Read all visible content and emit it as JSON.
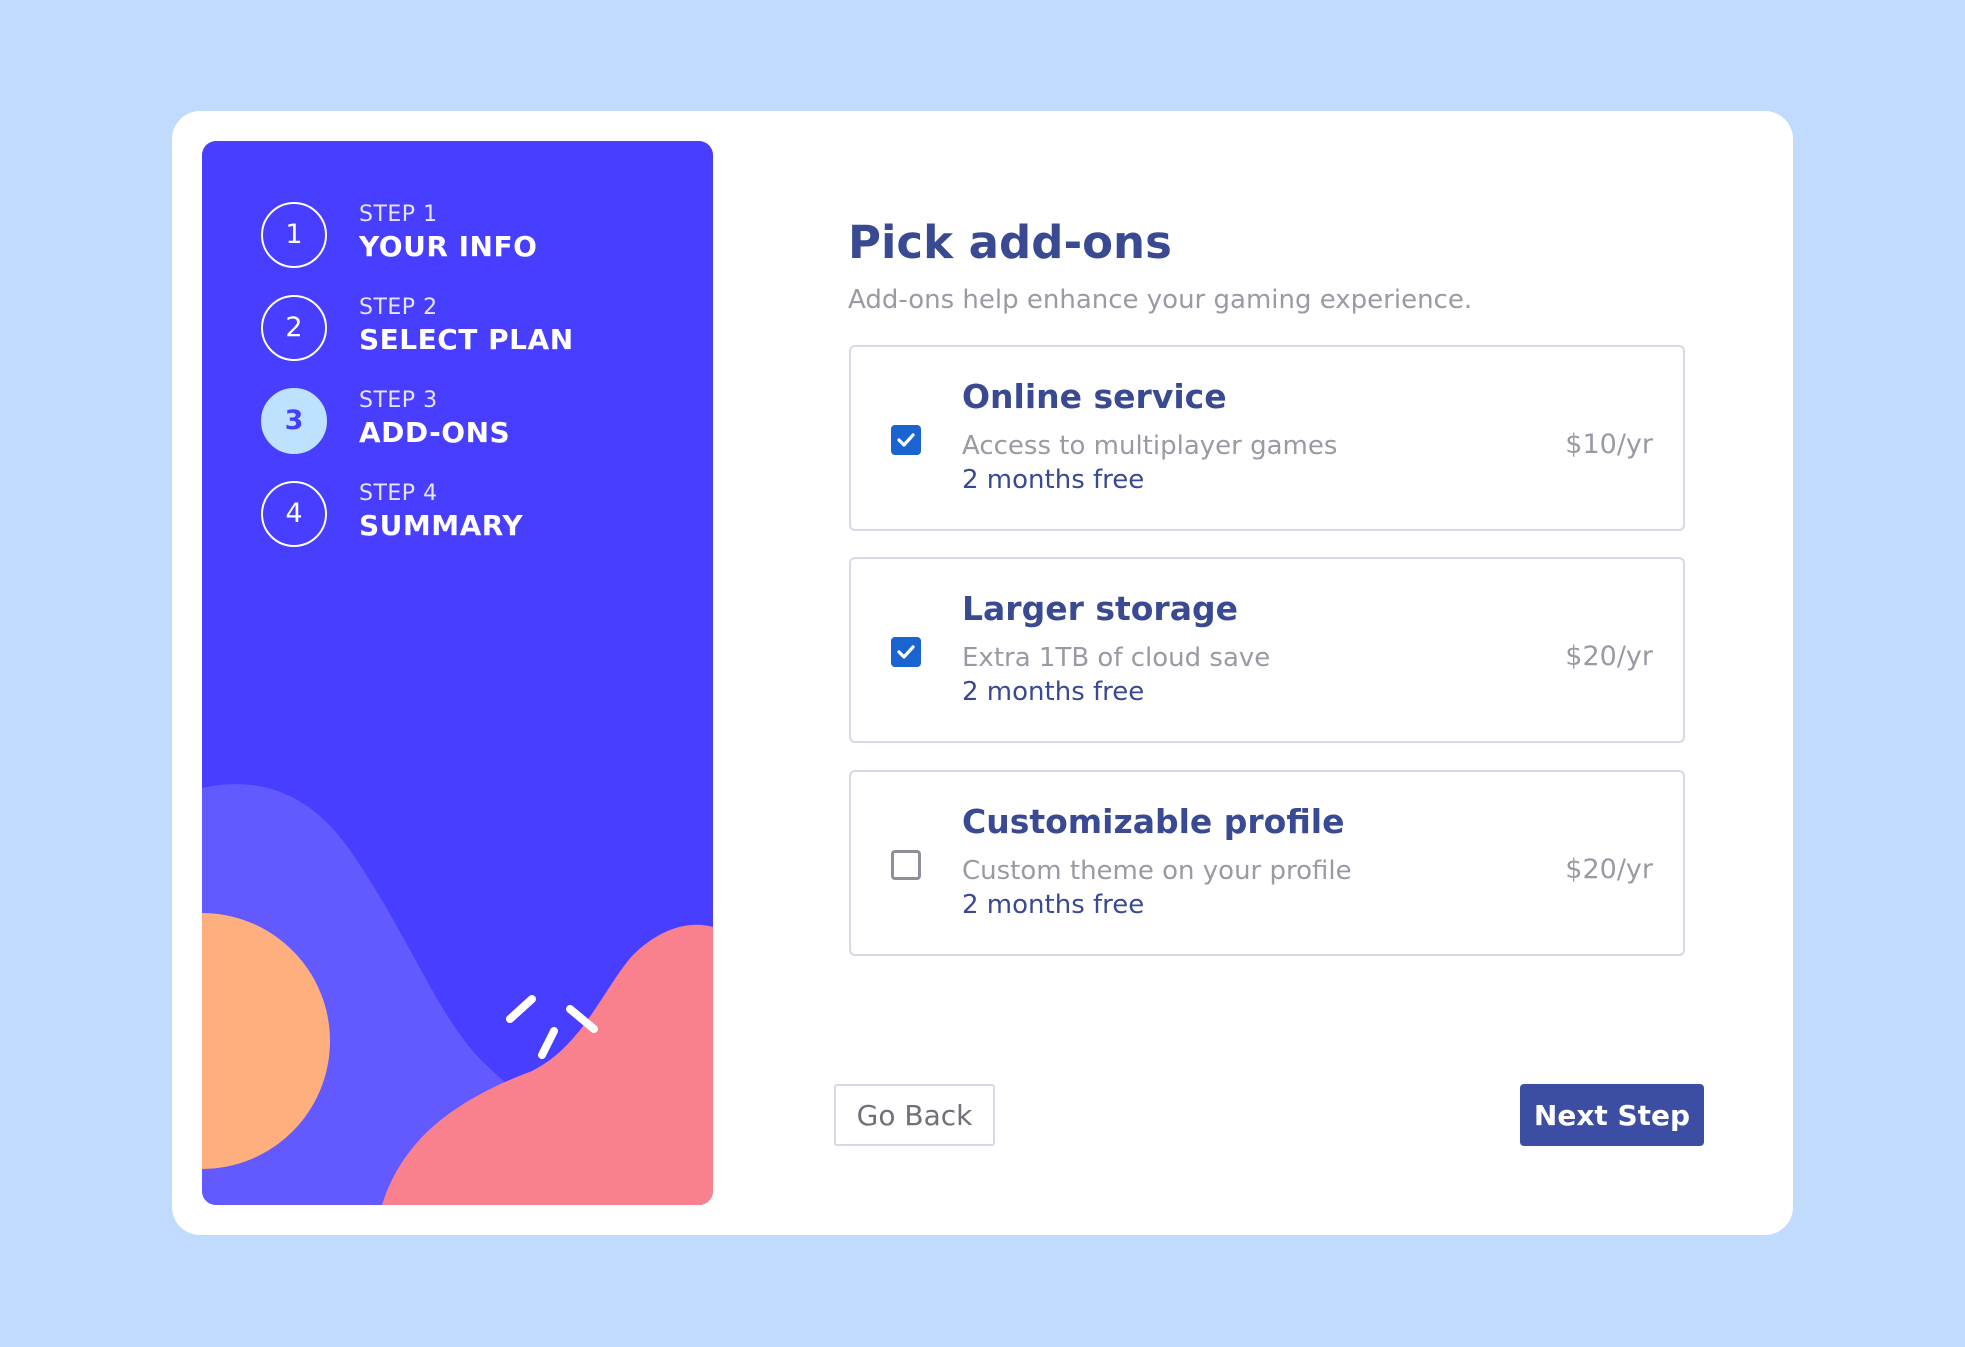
{
  "steps": [
    {
      "number": "1",
      "label": "STEP 1",
      "title": "YOUR INFO",
      "active": false
    },
    {
      "number": "2",
      "label": "STEP 2",
      "title": "SELECT PLAN",
      "active": false
    },
    {
      "number": "3",
      "label": "STEP 3",
      "title": "ADD-ONS",
      "active": true
    },
    {
      "number": "4",
      "label": "STEP 4",
      "title": "SUMMARY",
      "active": false
    }
  ],
  "main": {
    "title": "Pick add-ons",
    "subtitle": "Add-ons help enhance your gaming experience."
  },
  "addons": [
    {
      "name": "Online service",
      "description": "Access to multiplayer games",
      "promo": "2 months free",
      "price": "$10/yr",
      "checked": true
    },
    {
      "name": "Larger storage",
      "description": "Extra 1TB of cloud save",
      "promo": "2 months free",
      "price": "$20/yr",
      "checked": true
    },
    {
      "name": "Customizable profile",
      "description": "Custom theme on your profile",
      "promo": "2 months free",
      "price": "$20/yr",
      "checked": false
    }
  ],
  "buttons": {
    "back_label": "Go Back",
    "next_label": "Next Step"
  },
  "colors": {
    "page_background": "#c0dbfd",
    "sidebar": "#483eff",
    "active_step": "#bee2fd",
    "heading": "#3a4a92",
    "checkbox": "#1964d1",
    "next_button": "#3c4ea3",
    "sidebar_art_lavender": "#6259ff",
    "sidebar_art_orange": "#ffaf7e",
    "sidebar_art_pink": "#f9818e"
  }
}
